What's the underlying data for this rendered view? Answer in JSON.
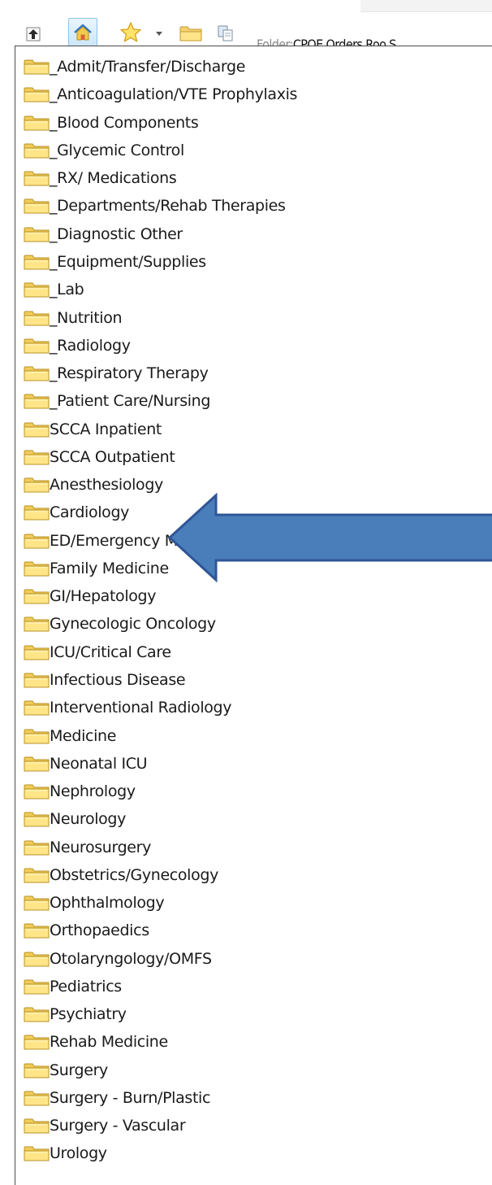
{
  "toolbar": {
    "icons": {
      "up": "up-arrow-icon",
      "home": "home-icon",
      "favorites": "star-icon",
      "dropdown": "dropdown-arrow-icon",
      "folder": "folder-icon",
      "copy": "copy-icon"
    },
    "folder_label": "Folder:",
    "folder_value": "CPOE Orders Roo.S"
  },
  "tree": {
    "item_icon": "folder-icon",
    "items": [
      "_Admit/Transfer/Discharge",
      "_Anticoagulation/VTE Prophylaxis",
      "_Blood Components",
      "_Glycemic Control",
      "_RX/ Medications",
      "_Departments/Rehab Therapies",
      "_Diagnostic Other",
      "_Equipment/Supplies",
      "_Lab",
      "_Nutrition",
      "_Radiology",
      "_Respiratory Therapy",
      "_Patient Care/Nursing",
      "SCCA Inpatient",
      "SCCA Outpatient",
      "Anesthesiology",
      "Cardiology",
      "ED/Emergency Medicine",
      "Family Medicine",
      "GI/Hepatology",
      "Gynecologic Oncology",
      "ICU/Critical Care",
      "Infectious Disease",
      "Interventional Radiology",
      "Medicine",
      "Neonatal ICU",
      "Nephrology",
      "Neurology",
      "Neurosurgery",
      "Obstetrics/Gynecology",
      "Ophthalmology",
      "Orthopaedics",
      "Otolaryngology/OMFS",
      "Pediatrics",
      "Psychiatry",
      "Rehab Medicine",
      "Surgery",
      "Surgery - Burn/Plastic",
      "Surgery - Vascular",
      "Urology"
    ]
  },
  "annotation": {
    "icon": "left-arrow-callout-icon",
    "points_to": "Cardiology",
    "fill_color": "#4a7ebb",
    "stroke_color": "#2f5597"
  }
}
